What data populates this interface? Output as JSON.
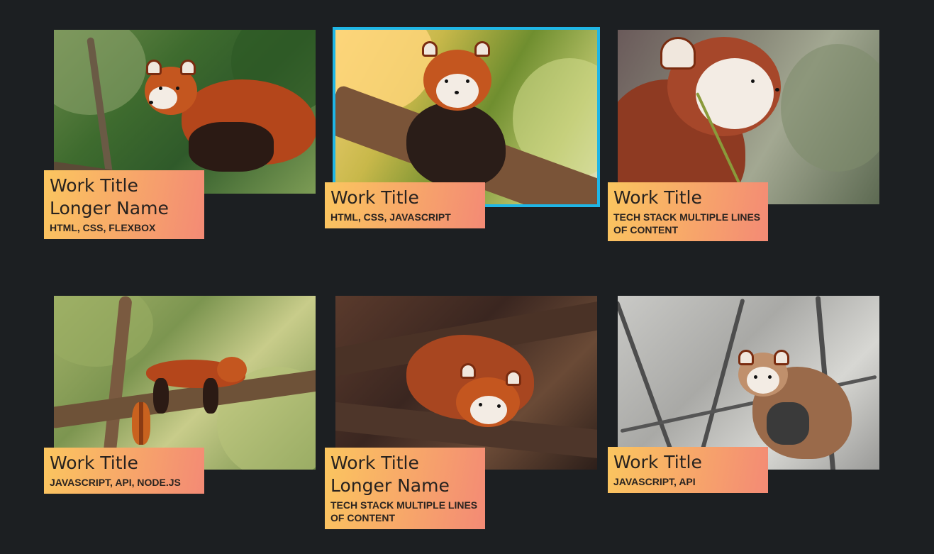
{
  "works": [
    {
      "title_line1": "Work Title",
      "title_line2": "Longer Name",
      "stack_line1": "HTML, CSS, FLEXBOX",
      "stack_line2": "",
      "image_icon": "red-panda-on-branch-photo",
      "focused": false
    },
    {
      "title_line1": "Work Title",
      "title_line2": "",
      "stack_line1": "HTML, CSS, JAVASCRIPT",
      "stack_line2": "",
      "image_icon": "red-panda-waving-photo",
      "focused": true
    },
    {
      "title_line1": "Work Title",
      "title_line2": "",
      "stack_line1": "TECH STACK MULTIPLE LINES",
      "stack_line2": "OF CONTENT",
      "image_icon": "red-panda-eating-bamboo-photo",
      "focused": false
    },
    {
      "title_line1": "Work Title",
      "title_line2": "",
      "stack_line1": "JAVASCRIPT, API, NODE.JS",
      "stack_line2": "",
      "image_icon": "red-panda-sleeping-on-tree-photo",
      "focused": false
    },
    {
      "title_line1": "Work Title",
      "title_line2": "Longer Name",
      "stack_line1": "TECH STACK MULTIPLE LINES",
      "stack_line2": "OF CONTENT",
      "image_icon": "red-panda-curled-in-logs-photo",
      "focused": false
    },
    {
      "title_line1": "Work Title",
      "title_line2": "",
      "stack_line1": "JAVASCRIPT, API",
      "stack_line2": "",
      "image_icon": "red-panda-in-bare-tree-photo",
      "focused": false
    }
  ],
  "colors": {
    "page_bg": "#1c1f22",
    "label_gradient_start": "#fbc65f",
    "label_gradient_end": "#f38a75",
    "focus_ring": "#1fb6e6"
  }
}
